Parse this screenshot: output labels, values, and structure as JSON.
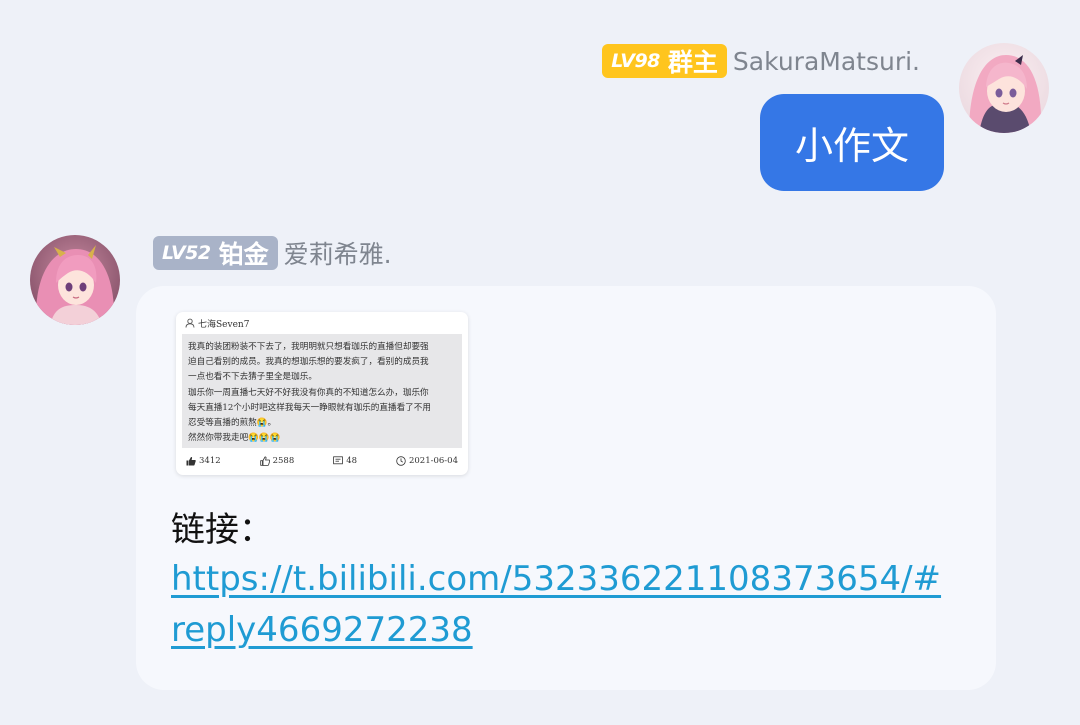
{
  "outgoing": {
    "sender": {
      "level": "LV98",
      "role": "群主",
      "name": "SakuraMatsuri."
    },
    "text": "小作文"
  },
  "incoming": {
    "sender": {
      "level": "LV52",
      "role": "铂金",
      "name": "爱莉希雅."
    },
    "comment_card": {
      "user": "七海Seven7",
      "lines": [
        "我真的装团粉装不下去了，我明明就只想看珈乐的直播但却要强",
        "迫自己看别的成员。我真的想珈乐想的要发疯了，看别的成员我",
        "一点也看不下去猜子里全是珈乐。",
        "珈乐你一周直播七天好不好我没有你真的不知道怎么办，珈乐你",
        "每天直播12个小时吧这样我每天一睁眼就有珈乐的直播看了不用",
        "忍受等直播的煎熬😭。",
        "然然你带我走吧😭😭😭"
      ],
      "likes": "3412",
      "thumbs": "2588",
      "replies": "48",
      "date": "2021-06-04"
    },
    "link_label": "链接：",
    "link_url": "https://t.bilibili.com/532336221108373654/#reply4669272238"
  },
  "colors": {
    "page_background": "#eef1f8",
    "outgoing_bubble": "#3577e6",
    "incoming_bubble": "#f6f8fd",
    "badge_gold": "#ffc51e",
    "badge_silver": "#a9b3c8",
    "link": "#1f9bd3",
    "sender_name": "#7f858f"
  },
  "icons": {
    "right_avatar": "anime-girl-avatar",
    "left_avatar": "anime-girl-avatar",
    "card_user": "user-icon",
    "card_likes": "thumbs-up-filled-icon",
    "card_thumbs": "thumbs-up-outline-icon",
    "card_replies": "comment-icon",
    "card_date": "clock-icon"
  }
}
